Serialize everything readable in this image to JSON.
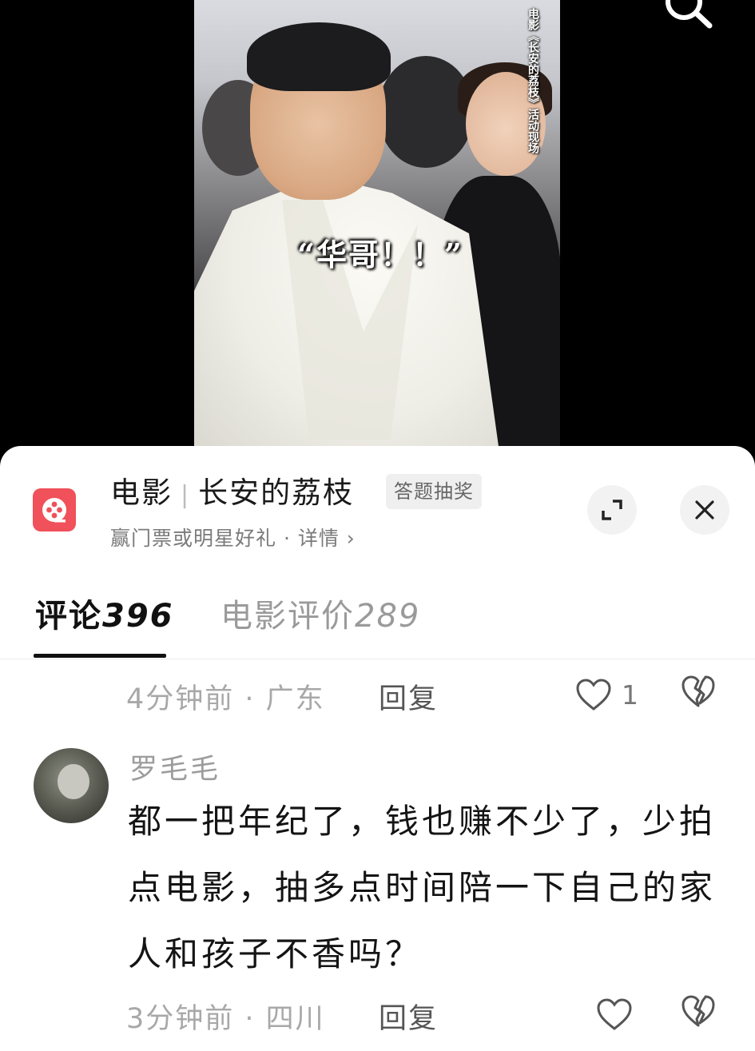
{
  "video": {
    "subtitle": "“华哥！！”",
    "side_caption": "电影《长安的荔枝》活动现场"
  },
  "movie_card": {
    "category": "电影",
    "title": "长安的荔枝",
    "badge": "答题抽奖",
    "subtitle": "赢门票或明星好礼 · 详情 ›",
    "logo_color": "#f0515a"
  },
  "tabs": [
    {
      "label": "评论",
      "count": "396",
      "active": true
    },
    {
      "label": "电影评价",
      "count": "289",
      "active": false
    }
  ],
  "prev_comment_meta": {
    "time_location": "4分钟前 · 广东",
    "reply_label": "回复",
    "like_count": "1"
  },
  "comment": {
    "username": "罗毛毛",
    "text": "都一把年纪了，钱也赚不少了，少拍点电影，抽多点时间陪一下自己的家人和孩子不香吗？",
    "time_location": "3分钟前 · 四川",
    "reply_label": "回复",
    "like_count": ""
  },
  "icons": {
    "search": "search-icon",
    "expand": "expand-icon",
    "close": "close-icon",
    "heart": "heart-icon",
    "dislike": "broken-heart-icon"
  }
}
